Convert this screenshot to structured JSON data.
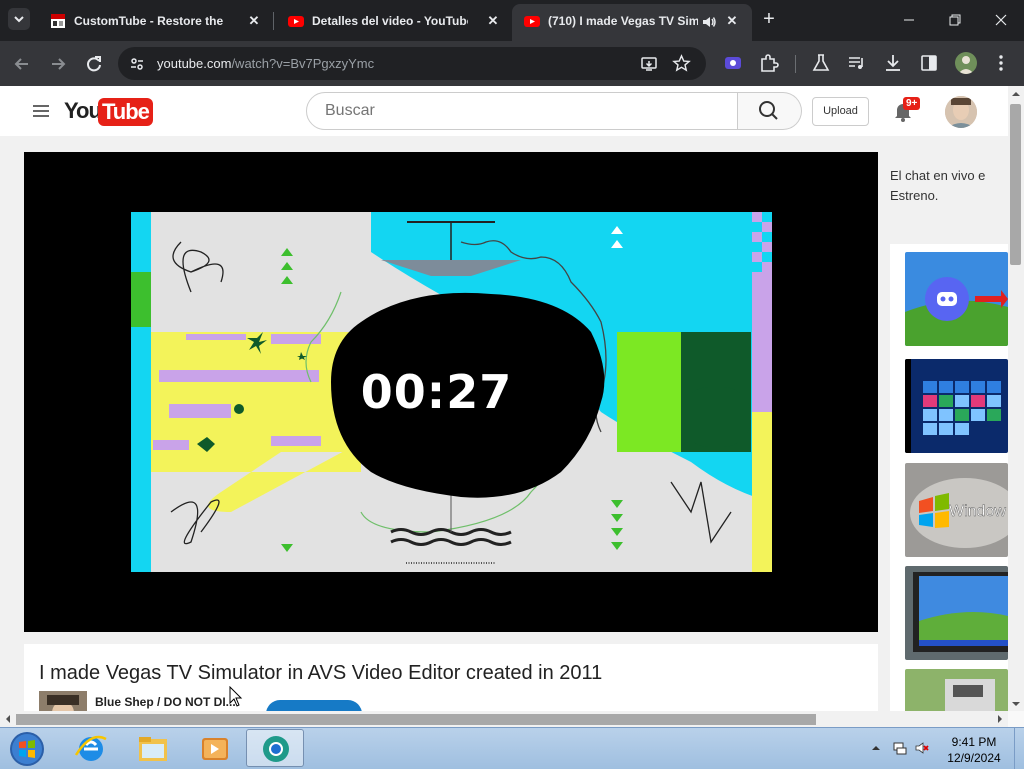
{
  "browser": {
    "tabs": [
      {
        "title": "CustomTube - Restore the Old",
        "favicon": "customtube-favicon"
      },
      {
        "title": "Detalles del video - YouTube St",
        "favicon": "youtube-studio-favicon"
      },
      {
        "title": "(710) I made Vegas TV Sim",
        "favicon": "youtube-favicon",
        "audio": "speaker-icon",
        "active": true
      }
    ],
    "url_host": "youtube.com",
    "url_path": "/watch?v=Bv7PgxzyYmc"
  },
  "youtube": {
    "logo_you": "You",
    "logo_tube": "Tube",
    "search_placeholder": "Buscar",
    "upload_label": "Upload",
    "notification_count": "9+",
    "video": {
      "timer_text": "00:27",
      "title": "I made Vegas TV Simulator in AVS Video Editor created in 2011",
      "channel": "Blue Shep / DO NOT DI..."
    },
    "chat_note": "El chat en vivo e Estreno."
  },
  "taskbar": {
    "apps": [
      "start-orb-icon",
      "internet-explorer-icon",
      "file-explorer-icon",
      "media-player-icon",
      "chrome-icon"
    ],
    "time": "9:41 PM",
    "date": "12/9/2024"
  },
  "colors": {
    "yt_red": "#e62117",
    "chrome_dark": "#202124",
    "chrome_toolbar": "#35363a",
    "taskbar_blue": "#b9d1ea"
  }
}
